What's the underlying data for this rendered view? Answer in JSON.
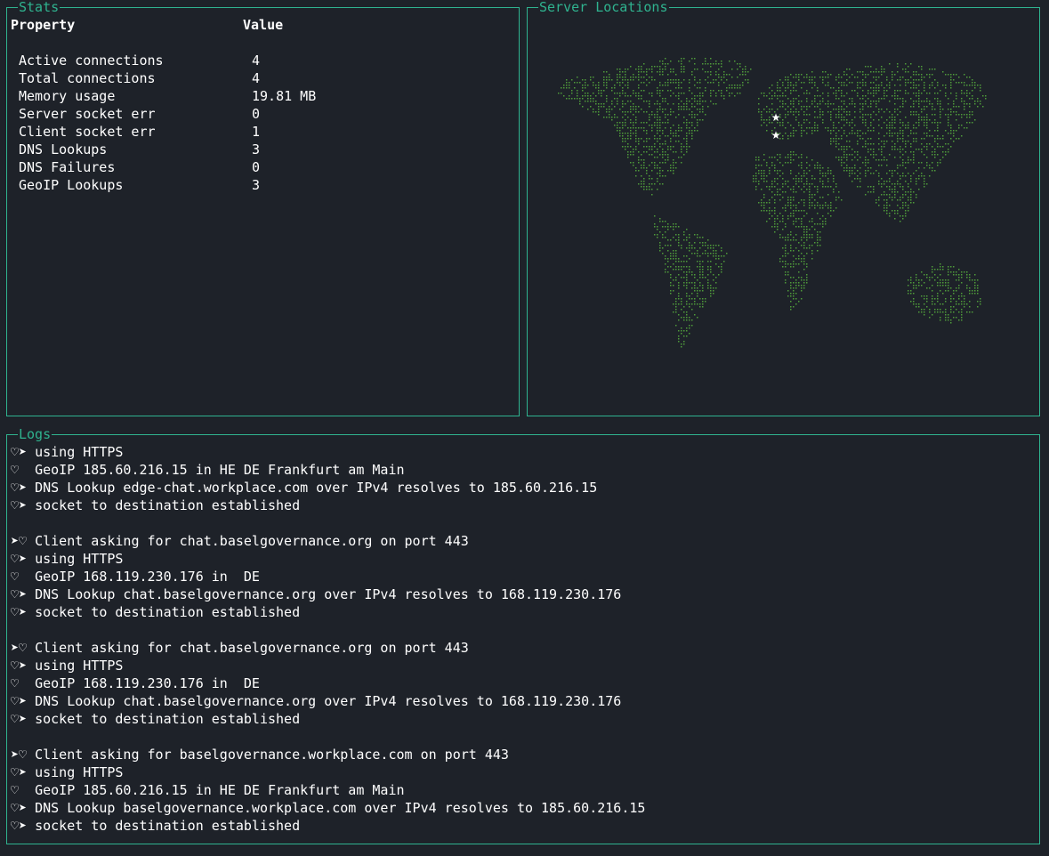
{
  "stats_panel": {
    "title": "Stats",
    "header": {
      "property": "Property",
      "value": "Value"
    },
    "rows": [
      {
        "property": "Active connections",
        "value": "4"
      },
      {
        "property": "Total connections",
        "value": "4"
      },
      {
        "property": "Memory usage",
        "value": "19.81 MB"
      },
      {
        "property": "Server socket err",
        "value": "0"
      },
      {
        "property": "Client socket err",
        "value": "1"
      },
      {
        "property": "DNS Lookups",
        "value": "3"
      },
      {
        "property": "DNS Failures",
        "value": "0"
      },
      {
        "property": "GeoIP Lookups",
        "value": "3"
      }
    ]
  },
  "map_panel": {
    "title": "Server Locations",
    "marker_glyph": "★",
    "dot_color": "#4f9a3a",
    "marker_color": "#ffffff"
  },
  "logs_panel": {
    "title": "Logs",
    "lines": [
      "♡➤ using HTTPS",
      "♡  GeoIP 185.60.216.15 in HE DE Frankfurt am Main",
      "♡➤ DNS Lookup edge-chat.workplace.com over IPv4 resolves to 185.60.216.15",
      "♡➤ socket to destination established",
      "",
      "➤♡ Client asking for chat.baselgovernance.org on port 443",
      "♡➤ using HTTPS",
      "♡  GeoIP 168.119.230.176 in  DE",
      "♡➤ DNS Lookup chat.baselgovernance.org over IPv4 resolves to 168.119.230.176",
      "♡➤ socket to destination established",
      "",
      "➤♡ Client asking for chat.baselgovernance.org on port 443",
      "♡➤ using HTTPS",
      "♡  GeoIP 168.119.230.176 in  DE",
      "♡➤ DNS Lookup chat.baselgovernance.org over IPv4 resolves to 168.119.230.176",
      "♡➤ socket to destination established",
      "",
      "➤♡ Client asking for baselgovernance.workplace.com on port 443",
      "♡➤ using HTTPS",
      "♡  GeoIP 185.60.216.15 in HE DE Frankfurt am Main",
      "♡➤ DNS Lookup baselgovernance.workplace.com over IPv4 resolves to 185.60.216.15",
      "♡➤ socket to destination established"
    ]
  },
  "colors": {
    "background": "#1e2229",
    "border": "#2fb38f",
    "text": "#ffffff"
  }
}
